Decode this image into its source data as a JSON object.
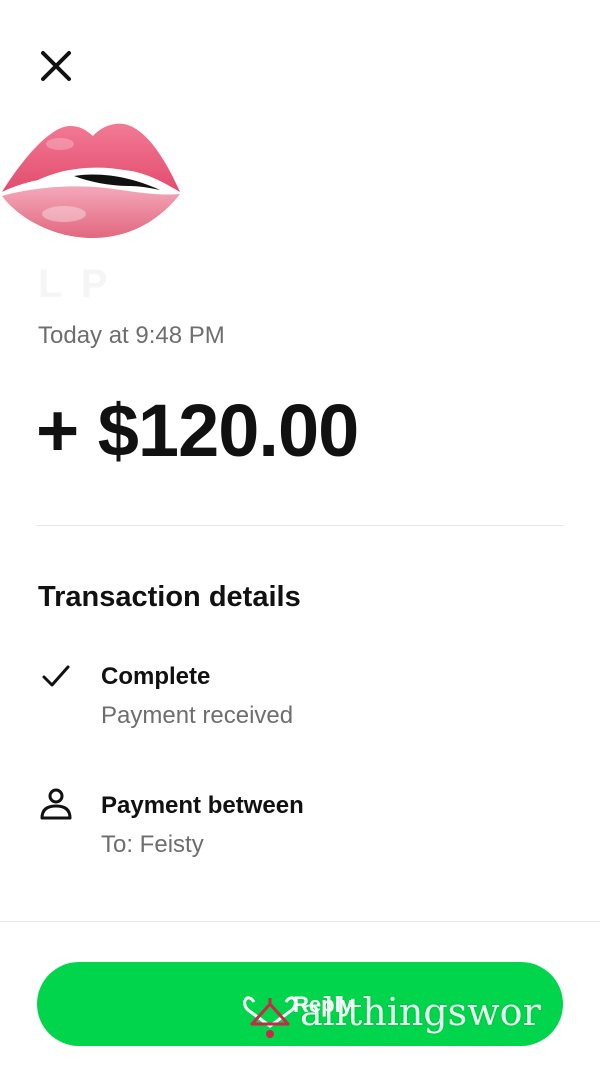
{
  "header": {
    "close_icon": "close-icon"
  },
  "sender": {
    "avatar_icon": "biting-lip-emoji",
    "name": "L P"
  },
  "transaction": {
    "timestamp": "Today at 9:48 PM",
    "amount": "+ $120.00"
  },
  "details": {
    "title": "Transaction details",
    "items": [
      {
        "icon": "checkmark-icon",
        "title": "Complete",
        "subtitle": "Payment received"
      },
      {
        "icon": "person-icon",
        "title": "Payment between",
        "subtitle": "To: Feisty"
      }
    ]
  },
  "footer": {
    "reply_label": "Reply",
    "accent_color": "#00d54b"
  },
  "watermark": {
    "text": "allthingswor"
  }
}
